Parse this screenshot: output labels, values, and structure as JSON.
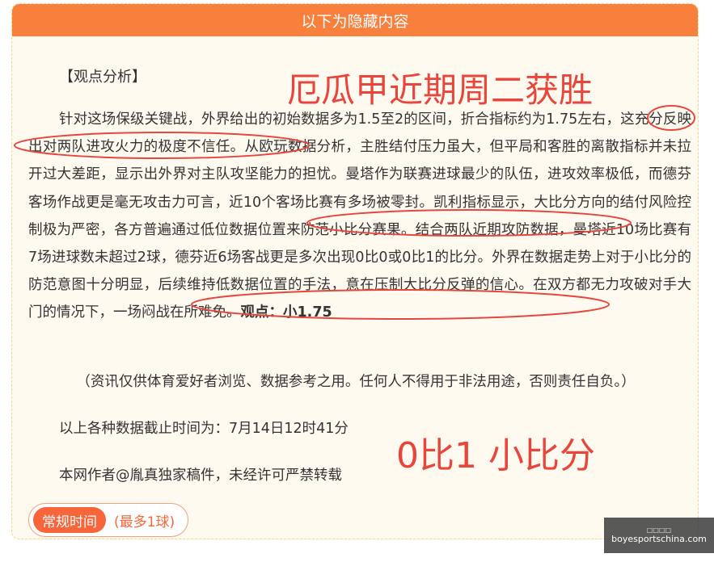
{
  "header": {
    "title": "以下为隐藏内容"
  },
  "article": {
    "heading": "【观点分析】",
    "p1_a": "针对这场保级关键战，外界给出的初始数据多为1.5至2的区间，折合指标约为1.75左右，这充分反映出对两队进攻火力的极度不信任。从欧玩数据分析，主胜结付压力虽大，但平局和客胜的离散指标并未拉开过大差距，显示出外界对主队攻坚能力的担忧。曼塔作为联赛进球最少的队伍，进攻效率极低，而德芬客场作战更是毫无攻击力可言，近10个客场比赛有多场被零封。凯利指标显示，大比分方向的结付风险控制极为严密，各方普遍通过低位数据位置来防范小比分赛果。结合两队近期攻防数据，曼塔近10场比赛有7场进球数未超过2球，德芬近6场客战更是多次出现0比0或0比1的比分。外界在数据走势上对于小比分的防范意图十分明显，后续维持低数据位置的手法，意在压制大比分反弹的信心。在双方都无力攻破对手大门的情况下，一场闷战在所难免。",
    "p1_bold": "观点：小1.75",
    "disclaimer": "（资讯仅供体育爱好者浏览、数据参考之用。任何人不得用于非法用途，否则责任自负。）",
    "cutoff": "以上各种数据截止时间为：7月14日12时41分",
    "author": "本网作者@胤真独家稿件，未经许可严禁转载"
  },
  "overlay": {
    "title": "厄瓜甲近期周二获胜",
    "score": "0比1 小比分"
  },
  "tag": {
    "label": "常规时间",
    "sub": "(最多1球)"
  },
  "watermark": {
    "top": "□□□□",
    "site": "boyesportschina.com"
  },
  "colors": {
    "accent": "#f97f3c",
    "overlay_red": "#e8463c",
    "tag_orange": "#f7653a"
  }
}
